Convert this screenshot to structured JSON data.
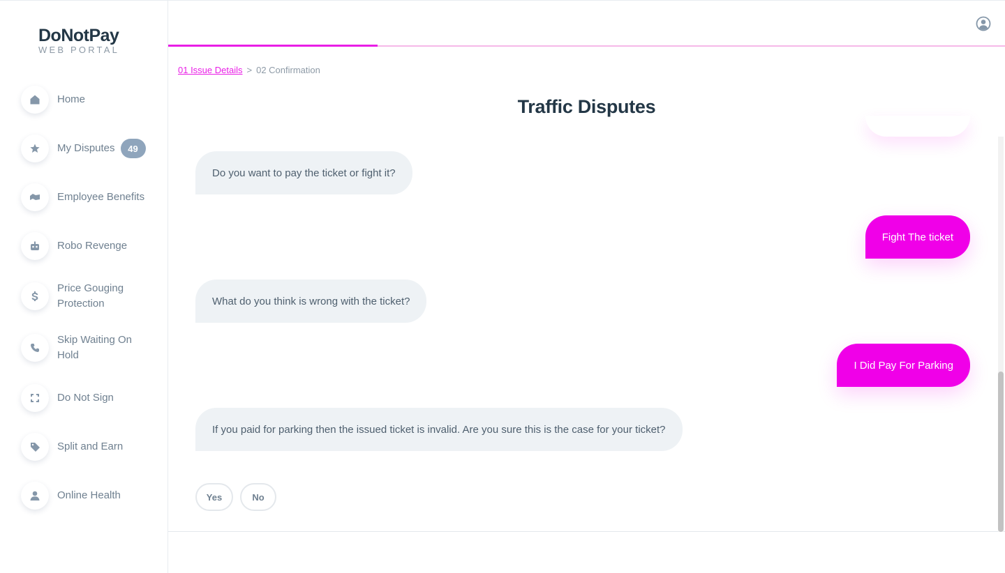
{
  "logo": {
    "main": "DoNotPay",
    "sub": "WEB PORTAL"
  },
  "sidebar": {
    "items": [
      {
        "label": "Home",
        "icon": "home-icon"
      },
      {
        "label": "My Disputes",
        "icon": "star-icon",
        "badge": "49"
      },
      {
        "label": "Employee Benefits",
        "icon": "benefits-icon"
      },
      {
        "label": "Robo Revenge",
        "icon": "robot-icon"
      },
      {
        "label": "Price Gouging Protection",
        "icon": "dollar-icon"
      },
      {
        "label": "Skip Waiting On Hold",
        "icon": "phone-icon"
      },
      {
        "label": "Do Not Sign",
        "icon": "scan-icon"
      },
      {
        "label": "Split and Earn",
        "icon": "tag-icon"
      },
      {
        "label": "Online Health",
        "icon": "person-icon"
      }
    ]
  },
  "progress": {
    "value": 0.25
  },
  "breadcrumb": {
    "step1": "01 Issue Details",
    "separator": ">",
    "step2": "02 Confirmation"
  },
  "page": {
    "title": "Traffic Disputes"
  },
  "chat": {
    "messages": [
      {
        "from": "bot",
        "text": "Do you want to pay the ticket or fight it?"
      },
      {
        "from": "user",
        "text": "Fight The ticket"
      },
      {
        "from": "bot",
        "text": "What do you think is wrong with the ticket?"
      },
      {
        "from": "user",
        "text": "I Did Pay For Parking"
      },
      {
        "from": "bot",
        "text": "If you paid for parking then the issued ticket is invalid. Are you sure this is the case for your ticket?"
      }
    ],
    "answers": {
      "yes": "Yes",
      "no": "No"
    }
  },
  "colors": {
    "accent": "#f000e8",
    "bot_bubble": "#eef2f5",
    "title": "#233746"
  }
}
